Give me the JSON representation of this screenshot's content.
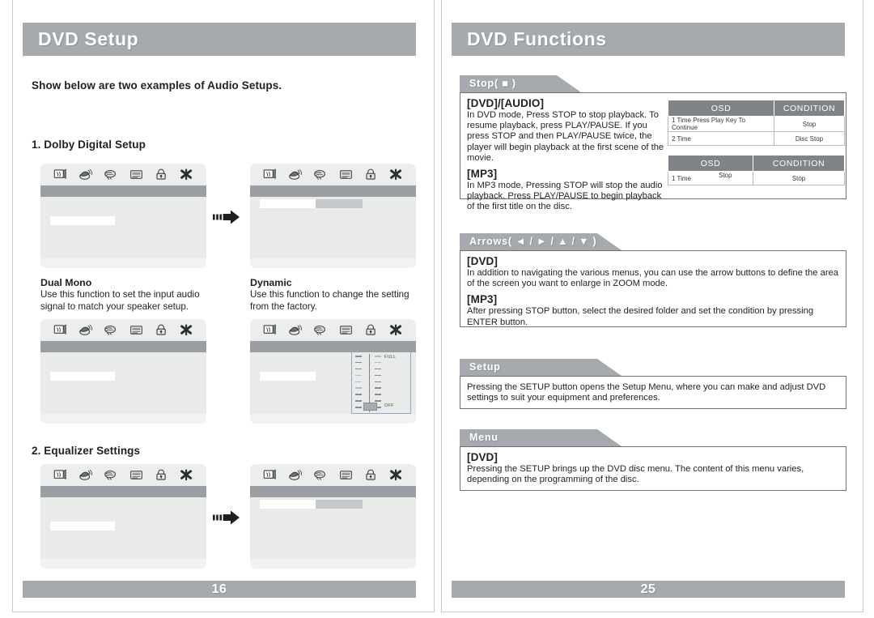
{
  "left_page": {
    "banner_title": "DVD Setup",
    "page_number": "16",
    "intro": "Show below are two examples of Audio Setups.",
    "sections": [
      {
        "heading": "1. Dolby Digital Setup"
      },
      {
        "heading": "2. Equalizer Settings"
      }
    ],
    "captions": [
      {
        "title": "Dual Mono",
        "text": "Use this function to set the input audio signal to match your speaker setup."
      },
      {
        "title": "Dynamic",
        "text": "Use this function to change the setting from the factory."
      }
    ],
    "osd_icons": [
      "screen-icon",
      "audio-icon",
      "disc-icon",
      "display-icon",
      "lock-icon",
      "exit-icon"
    ],
    "slider": {
      "top_label": "FULL",
      "bottom_label": "OFF"
    }
  },
  "right_page": {
    "banner_title": "DVD Functions",
    "page_number": "25",
    "blocks": [
      {
        "tab_label": "Stop( ■ )",
        "entries": [
          {
            "heading": "[DVD]/[AUDIO]",
            "text": "In DVD mode, Press STOP to stop playback. To resume playback, press PLAY/PAUSE. If you press STOP and then PLAY/PAUSE twice, the player will begin playback at the first scene of the movie."
          },
          {
            "heading": "[MP3]",
            "text": "In MP3 mode, Pressing STOP will stop the audio playback. Press PLAY/PAUSE to begin playback of the first title on the disc."
          }
        ],
        "tables": [
          {
            "headers": [
              "OSD",
              "CONDITION"
            ],
            "rows": [
              {
                "osd": "1 Time Press Play Key To Continue",
                "osd_extra": "",
                "condition": "Stop"
              },
              {
                "osd": "2 Time",
                "osd_extra": "",
                "condition": "Disc Stop"
              }
            ]
          },
          {
            "headers": [
              "OSD",
              "CONDITION"
            ],
            "rows": [
              {
                "osd": "1 Time",
                "osd_extra": "Stop",
                "condition": "Stop"
              }
            ]
          }
        ]
      },
      {
        "tab_label": "Arrows( ◄ / ► / ▲ / ▼ )",
        "entries": [
          {
            "heading": "[DVD]",
            "text": "In addition to navigating the various menus, you can use the arrow buttons to define the area of the screen you want to enlarge in ZOOM mode."
          },
          {
            "heading": "[MP3]",
            "text": "After pressing STOP button, select the desired folder and set the condition by pressing ENTER button."
          }
        ]
      },
      {
        "tab_label": "Setup",
        "entries": [
          {
            "heading": "",
            "text": "Pressing the SETUP button opens the Setup Menu, where you can make and adjust DVD settings to suit your equipment and preferences."
          }
        ]
      },
      {
        "tab_label": "Menu",
        "entries": [
          {
            "heading": "[DVD]",
            "text": "Pressing the SETUP brings up the DVD disc menu. The content of this menu varies, depending on the programming of the disc."
          }
        ]
      }
    ]
  },
  "colors": {
    "banner_grey": "#a6a9ad",
    "tab_grey": "#a6a9ad",
    "table_header_grey": "#808387",
    "osd_menubar_grey": "#9b9ea2",
    "body_border": "#6d7073",
    "page_border": "#c9cacb"
  }
}
